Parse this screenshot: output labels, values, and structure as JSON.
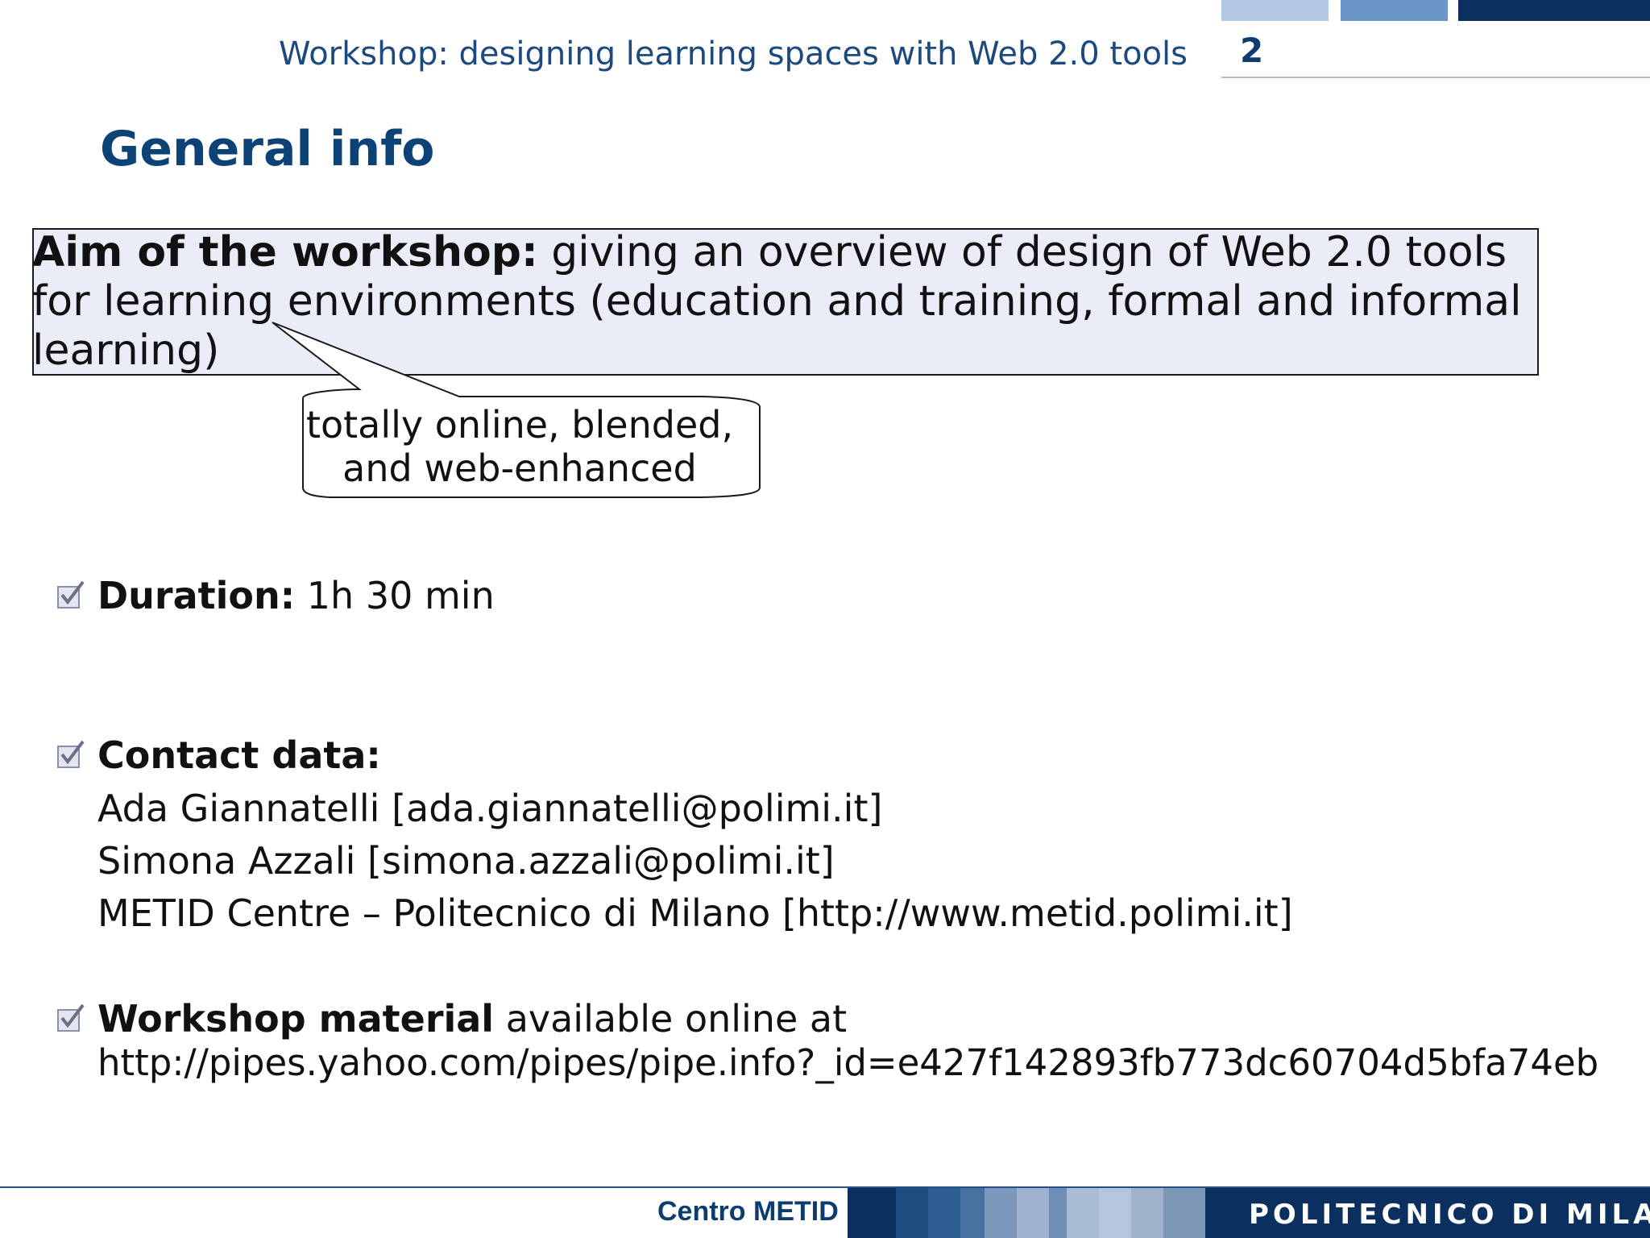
{
  "header": {
    "title": "Workshop: designing learning spaces with Web 2.0 tools",
    "page_number": "2"
  },
  "slide": {
    "title": "General info"
  },
  "aim": {
    "label": "Aim of the workshop:",
    "text_line1": " giving an overview of design of Web 2.0 tools",
    "text_line2": "for learning environments (education and training, formal and informal",
    "text_line3": "learning)"
  },
  "callout": {
    "line1": "totally online, blended,",
    "line2": "and web-enhanced"
  },
  "duration": {
    "label": "Duration:",
    "value": " 1h 30 min"
  },
  "contact": {
    "label": "Contact data:",
    "lines": [
      "Ada Giannatelli [ada.giannatelli@polimi.it]",
      "Simona Azzali [simona.azzali@polimi.it]",
      "METID Centre – Politecnico di Milano [http://www.metid.polimi.it]"
    ]
  },
  "material": {
    "label": "Workshop material",
    "text": " available online at",
    "url": "http://pipes.yahoo.com/pipes/pipe.info?_id=e427f142893fb773dc60704d5bfa74eb"
  },
  "footer": {
    "centro": "Centro METID",
    "brand": "POLITECNICO DI MILANO"
  },
  "colors": {
    "accent": "#0d4277",
    "header_text": "#1c4a7e",
    "aim_box_fill": "#eaedf8",
    "footer_dark": "#0b2f5e"
  },
  "icons": {
    "bullet": "checkbox-checked-icon"
  }
}
